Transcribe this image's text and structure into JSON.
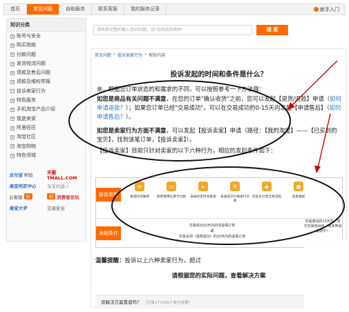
{
  "topnav": {
    "tabs": [
      "首页",
      "常见问题",
      "自助服务",
      "联系客服",
      "我的服务记录"
    ],
    "guide": "新手入门"
  },
  "sidebar": {
    "heading": "知识分类",
    "items": [
      {
        "label": "账号与安全",
        "icon": "plus"
      },
      {
        "label": "购买指南",
        "icon": "plus"
      },
      {
        "label": "付款问题",
        "icon": "plus"
      },
      {
        "label": "发货物流问题",
        "icon": "plus"
      },
      {
        "label": "退款及售后问题",
        "icon": "plus"
      },
      {
        "label": "退款及维权举报",
        "icon": "plus"
      },
      {
        "label": "投诉卖家行为",
        "icon": "minus"
      },
      {
        "label": "特色服务",
        "icon": "plus"
      },
      {
        "label": "手机淘宝产品介绍",
        "icon": "plus"
      },
      {
        "label": "我是卖家",
        "icon": "plus"
      },
      {
        "label": "阿里旺旺",
        "icon": "plus"
      },
      {
        "label": "淘宝社区",
        "icon": "plus"
      },
      {
        "label": "淘宝购物",
        "icon": "plus"
      },
      {
        "label": "特色领域",
        "icon": "plus"
      }
    ],
    "partners": {
      "p1": "支付宝",
      "p1b": "帮助",
      "p2": "天猫 TMALL.COM",
      "p3": "淘宝判定中心",
      "p4": "淘宝机器人",
      "p5": "云客服",
      "p5pill": "招",
      "p6pill": "招",
      "p6": "消费者论坛",
      "p7": "淘宝大学",
      "p8": "交易安全"
    }
  },
  "search": {
    "placeholder": "请简单完整的输入您的问题，如\"如何找回密码\"",
    "button": "搜 索"
  },
  "breadcrumb": [
    "常见问题",
    "投诉卖家行为",
    "帮助内容"
  ],
  "article": {
    "title": "投诉发起的时间和条件是什么？",
    "p1": "亲，根据您订单状态的和需求的不同，可以按照参考一下方法哦：",
    "p2a": "如您是商品有关问题不满意",
    "p2b": "，在您的订单\"确认收货\"之前，您可以发起【退货/退款】申请（",
    "p2link": "如何申请退款？",
    "p2c": "）；如果您订单已经\"交易成功\"，可以在交易成功的0-15天内发起【申请售后】（",
    "p2link2": "如何申请售后？",
    "p2d": "）。",
    "p3a": "如您是卖家行为方面不满意",
    "p3b": "，可以发起【投诉卖家】申请（路径：【我的淘宝】——【已买到的宝贝】，找到该笔订单，【投诉卖家】）。",
    "p4": "【投诉卖家】目前只针对卖家的以下六种行为，相应的发起条件如下："
  },
  "table": {
    "label_type": "投诉类型",
    "label_cond": "发起条件",
    "types": [
      "承诺的没做到",
      "拒绝使用信用卡付款",
      "未按约定时间发货",
      "未按成交价格进行交易",
      "违反支付宝交易流程",
      "恶意骚扰"
    ],
    "cond_line1": "交易成功15天内的非退保订单",
    "cond_or": "或",
    "cond_line2": "交易关闭（退款成功）的15天内的退保订单",
    "cond_right": "交易成功的15天内，双方交易有纠纷（尚未申请退款中）"
  },
  "tip_label": "温馨提醒：",
  "tip_text": "投诉以上六种卖家行为，超过",
  "pick_text": "请根据您的实际问题，查看解决方案",
  "vote": {
    "question": "该解决方案靠谱吗？",
    "count": "（已有177026人参与投票）"
  }
}
